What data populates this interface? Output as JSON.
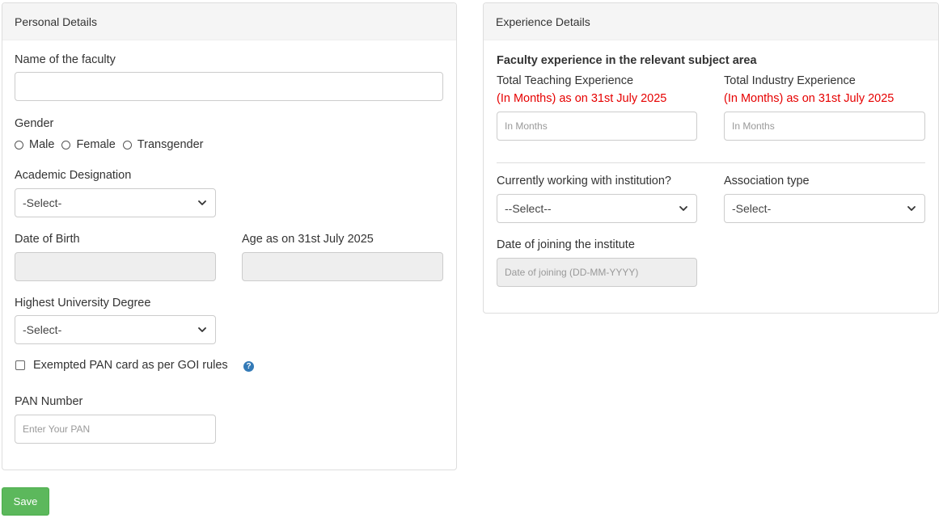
{
  "personal": {
    "heading": "Personal Details",
    "faculty_name_label": "Name of the faculty",
    "faculty_name_value": "",
    "gender_label": "Gender",
    "gender_options": [
      "Male",
      "Female",
      "Transgender"
    ],
    "academic_designation_label": "Academic Designation",
    "academic_designation_value": "-Select-",
    "dob_label": "Date of Birth",
    "dob_value": "",
    "age_label": "Age as on 31st July 2025",
    "age_value": "",
    "degree_label": "Highest University Degree",
    "degree_value": "-Select-",
    "pan_exempt_label": "Exempted PAN card as per GOI rules",
    "pan_exempt_checked": false,
    "pan_label": "PAN Number",
    "pan_placeholder": "Enter Your PAN"
  },
  "experience": {
    "heading": "Experience Details",
    "subject_heading": "Faculty experience in the relevant subject area",
    "teaching_label": "Total Teaching Experience",
    "teaching_note": "(In Months) as on 31st July 2025",
    "teaching_placeholder": "In Months",
    "industry_label": "Total Industry Experience",
    "industry_note": "(In Months) as on 31st July 2025",
    "industry_placeholder": "In Months",
    "working_label": "Currently working with institution?",
    "working_value": "--Select--",
    "association_label": "Association type",
    "association_value": "-Select-",
    "joining_label": "Date of joining the institute",
    "joining_placeholder": "Date of joining (DD-MM-YYYY)"
  },
  "actions": {
    "save_label": "Save"
  },
  "colors": {
    "save_button": "#5cb85c",
    "note_red": "#e60000",
    "help_icon": "#337ab7"
  },
  "icons": {
    "select_arrow": "chevron-down-icon",
    "help": "question-circle-icon"
  }
}
